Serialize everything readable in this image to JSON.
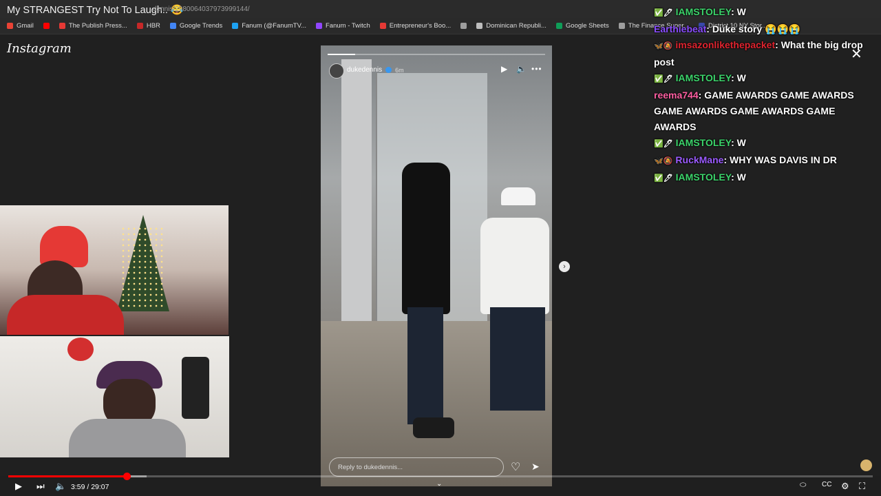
{
  "video": {
    "title": "My STRANGEST Try Not To Laugh.. 😂",
    "url_fragment": "dennis/2980064037973999144/"
  },
  "bookmarks": [
    {
      "label": "Gmail",
      "color": "#ea4335"
    },
    {
      "label": "",
      "color": "#ff0000"
    },
    {
      "label": "The Publish Press...",
      "color": "#e53935"
    },
    {
      "label": "HBR",
      "color": "#c62828"
    },
    {
      "label": "Google Trends",
      "color": "#4285f4"
    },
    {
      "label": "Fanum (@FanumTV...",
      "color": "#1da1f2"
    },
    {
      "label": "Fanum - Twitch",
      "color": "#9146ff"
    },
    {
      "label": "Entrepreneur's Boo...",
      "color": "#e53935"
    },
    {
      "label": "",
      "color": "#9e9e9e"
    },
    {
      "label": "Dominican Republi...",
      "color": "#bdbdbd"
    },
    {
      "label": "Google Sheets",
      "color": "#0f9d58"
    },
    {
      "label": "The Finance Super...",
      "color": "#9e9e9e"
    },
    {
      "label": "District 10 NY Stor...",
      "color": "#3949ab"
    }
  ],
  "instagram": {
    "logo_text": "Instagram",
    "story": {
      "username": "dukedennis",
      "time": "6m",
      "reply_placeholder": "Reply to dukedennis..."
    }
  },
  "chat": {
    "messages": [
      {
        "user": "IAMSTOLEY",
        "color": "#3cd46b",
        "badges": "✅🖊",
        "text": "W"
      },
      {
        "user": "Earthiebeat",
        "color": "#8a4dff",
        "badges": "",
        "text": "Duke story 😭😭😭"
      },
      {
        "user": "imsazonlikethepacket",
        "color": "#e0242f",
        "badges": "🦋🔕",
        "text": "What the big drop post"
      },
      {
        "user": "IAMSTOLEY",
        "color": "#3cd46b",
        "badges": "✅🖊",
        "text": "W"
      },
      {
        "user": "reema744",
        "color": "#ff5fa2",
        "badges": "",
        "text": "GAME AWARDS GAME AWARDS GAME AWARDS GAME AWARDS GAME AWARDS"
      },
      {
        "user": "IAMSTOLEY",
        "color": "#3cd46b",
        "badges": "✅🖊",
        "text": "W"
      },
      {
        "user": "RuckMane",
        "color": "#9b5bff",
        "badges": "🦋🔕",
        "text": "WHY WAS DAVIS IN DR"
      },
      {
        "user": "IAMSTOLEY",
        "color": "#3cd46b",
        "badges": "✅🖊",
        "text": "W"
      }
    ]
  },
  "player": {
    "current_time": "3:59",
    "duration": "29:07",
    "time_display": "3:59 / 29:07",
    "progress_fraction": 0.137,
    "buffered_fraction": 0.16
  },
  "colors": {
    "seek_red": "#ff0000",
    "background": "#1f1f1f"
  }
}
